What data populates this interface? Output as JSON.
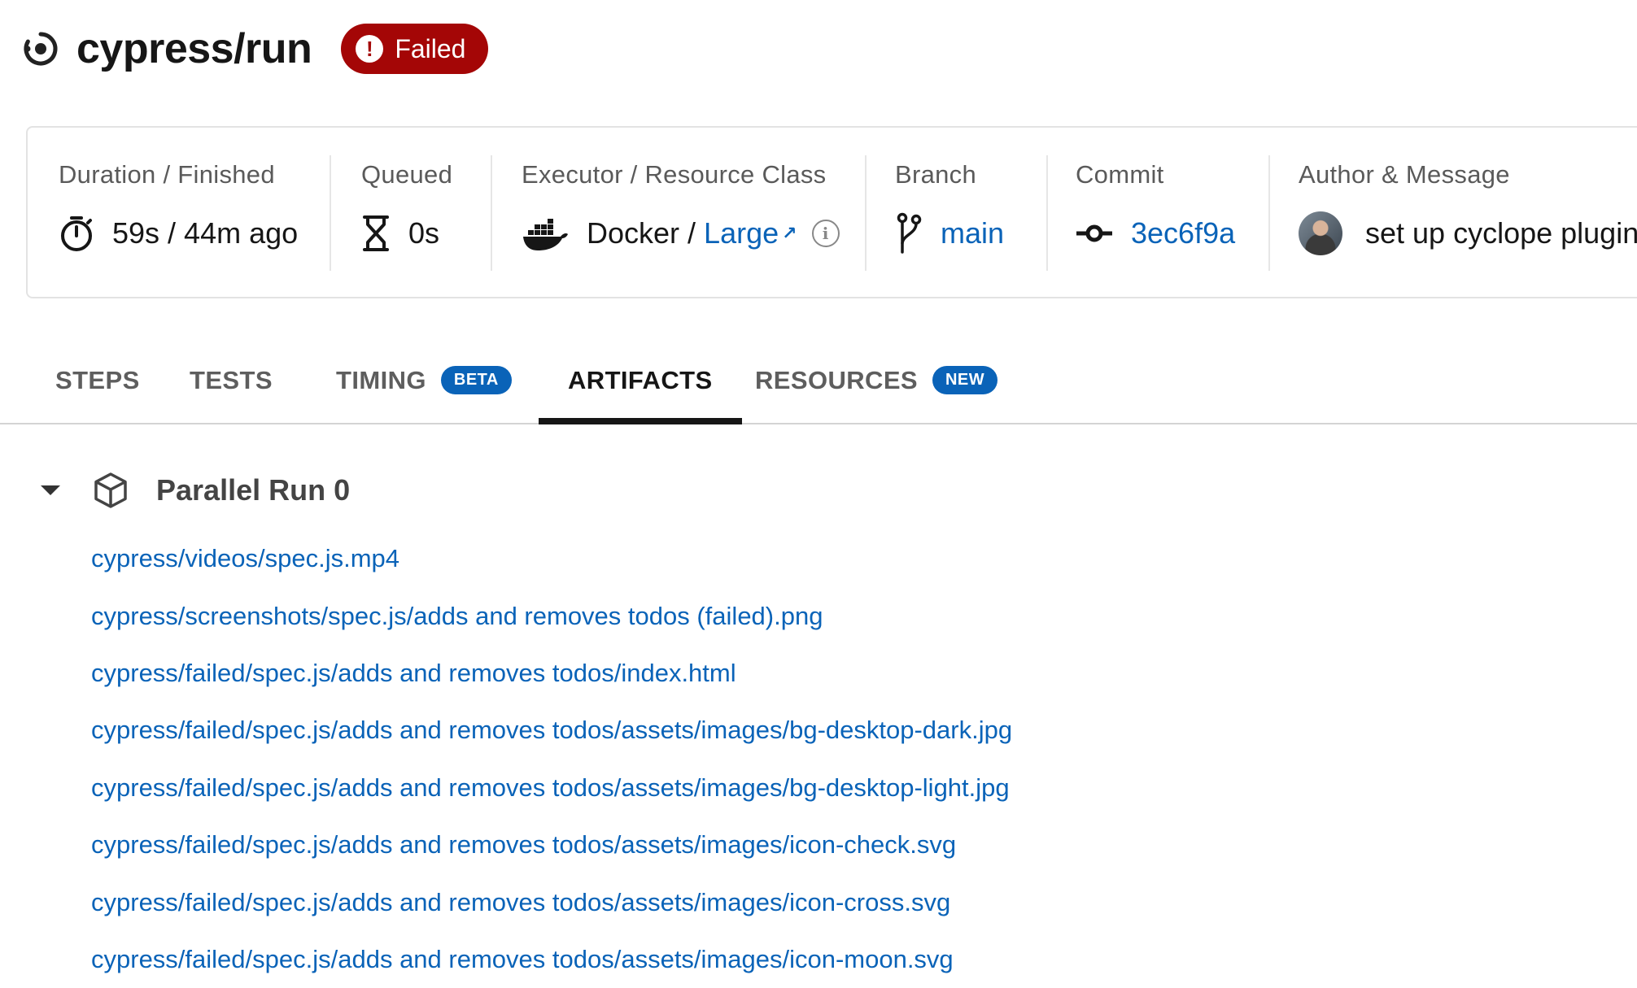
{
  "job": {
    "title": "cypress/run",
    "status": "Failed"
  },
  "info": {
    "duration": {
      "label": "Duration / Finished",
      "value": "59s / 44m ago"
    },
    "queued": {
      "label": "Queued",
      "value": "0s"
    },
    "executor": {
      "label": "Executor / Resource Class",
      "executor": "Docker",
      "separator": " / ",
      "resource_class": "Large",
      "ext_arrow": "↗",
      "info_glyph": "i"
    },
    "branch": {
      "label": "Branch",
      "value": "main"
    },
    "commit": {
      "label": "Commit",
      "value": "3ec6f9a"
    },
    "author": {
      "label": "Author & Message",
      "message": "set up cyclope plugin"
    }
  },
  "tabs": [
    {
      "label": "STEPS"
    },
    {
      "label": "TESTS"
    },
    {
      "label": "TIMING",
      "badge": "BETA"
    },
    {
      "label": "ARTIFACTS",
      "active": true
    },
    {
      "label": "RESOURCES",
      "badge": "NEW"
    }
  ],
  "run": {
    "title": "Parallel Run 0"
  },
  "artifacts": [
    "cypress/videos/spec.js.mp4",
    "cypress/screenshots/spec.js/adds and removes todos (failed).png",
    "cypress/failed/spec.js/adds and removes todos/index.html",
    "cypress/failed/spec.js/adds and removes todos/assets/images/bg-desktop-dark.jpg",
    "cypress/failed/spec.js/adds and removes todos/assets/images/bg-desktop-light.jpg",
    "cypress/failed/spec.js/adds and removes todos/assets/images/icon-check.svg",
    "cypress/failed/spec.js/adds and removes todos/assets/images/icon-cross.svg",
    "cypress/failed/spec.js/adds and removes todos/assets/images/icon-moon.svg"
  ],
  "colors": {
    "link": "#0a63b8",
    "failed": "#a40606",
    "pill": "#0a63b8"
  },
  "icons": {
    "job": "job-icon",
    "status": "alert-icon",
    "duration": "stopwatch-icon",
    "queued": "hourglass-icon",
    "executor": "docker-icon",
    "branch": "git-branch-icon",
    "commit": "git-commit-icon",
    "author": "avatar",
    "run": "box-icon",
    "collapse": "caret-down-icon"
  }
}
